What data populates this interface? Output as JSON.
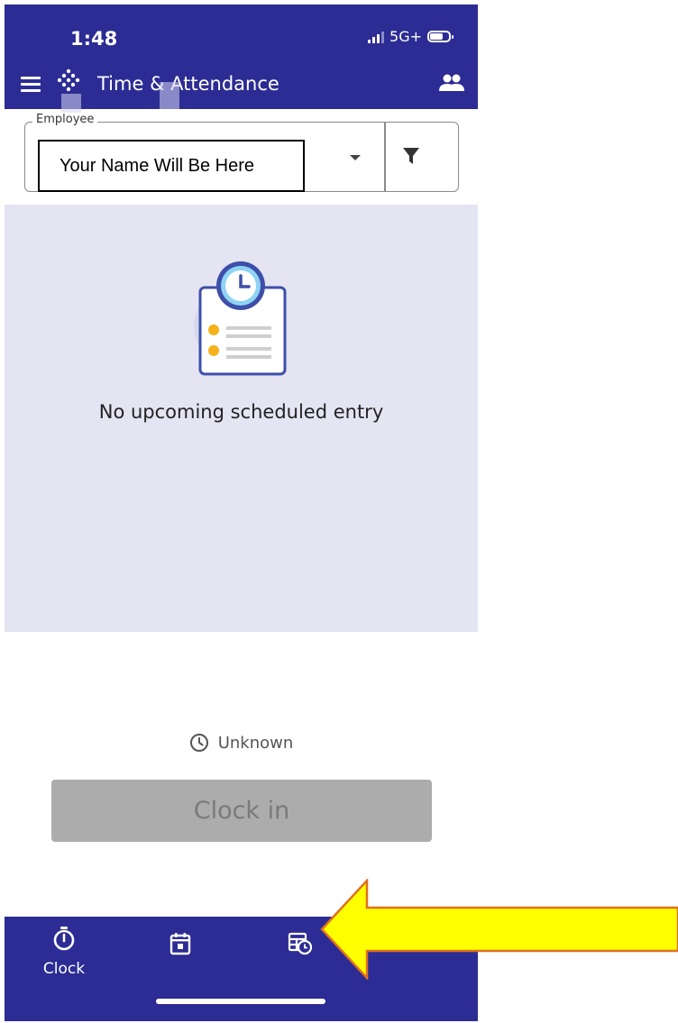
{
  "status_bar": {
    "time": "1:48",
    "network": "5G+"
  },
  "app_bar": {
    "title": "Time & Attendance",
    "icons": [
      "menu-icon",
      "app-logo-icon",
      "people-icon"
    ]
  },
  "employee_field": {
    "label": "Employee",
    "value": "Your Name Will Be Here",
    "icons": [
      "chevron-down-icon",
      "filter-icon"
    ]
  },
  "schedule": {
    "empty_message": "No upcoming scheduled entry",
    "illustration": "clipboard-clock-icon"
  },
  "clock_status": {
    "text": "Unknown",
    "icon": "clock-icon"
  },
  "clock_in_button": {
    "label": "Clock in",
    "disabled": true
  },
  "bottom_nav": {
    "items": [
      {
        "label": "Clock",
        "icon": "stopwatch-icon",
        "active": true
      },
      {
        "label": "",
        "icon": "calendar-icon",
        "active": false
      },
      {
        "label": "",
        "icon": "timesheet-icon",
        "active": false
      }
    ]
  },
  "colors": {
    "brand": "#2c2c94",
    "panel_background": "#e4e4f3",
    "disabled_button": "#acacac",
    "annotation_arrow": "#ffff00",
    "annotation_arrow_border": "#e07020"
  }
}
